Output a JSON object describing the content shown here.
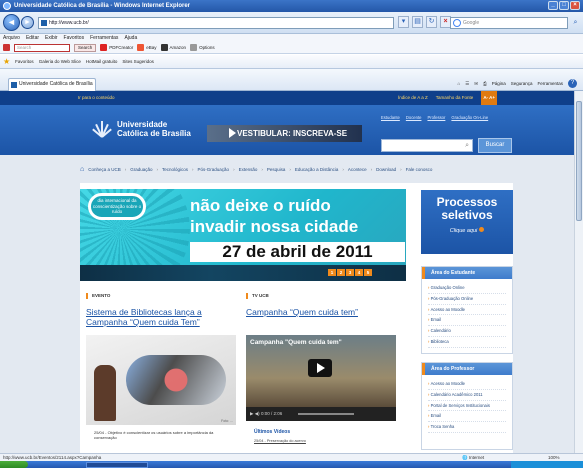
{
  "window": {
    "title": "Universidade Católica de Brasília - Windows Internet Explorer"
  },
  "address": {
    "url": "http://www.ucb.br/",
    "search_placeholder": "Google"
  },
  "menu": [
    "Arquivo",
    "Editar",
    "Exibir",
    "Favoritos",
    "Ferramentas",
    "Ajuda"
  ],
  "toolbar": {
    "search_placeholder": "Search",
    "search_btn": "Search",
    "items": [
      "PDFCreator",
      "eBay",
      "Amazon",
      "Options"
    ]
  },
  "favorites": {
    "label": "Favoritos",
    "items": [
      "Galeria do Web Slice",
      "HotMail gratuito",
      "Sites Sugeridos"
    ]
  },
  "tab": {
    "title": "Universidade Católica de Brasília"
  },
  "commandbar": [
    "Página",
    "Segurança",
    "Ferramentas"
  ],
  "site": {
    "skip_link": "Ir para o conteúdo",
    "access_links": [
      "Índice de A a Z",
      "Tamanho da Fonte"
    ],
    "access_badge": "A-  A+",
    "logo_line1": "Universidade",
    "logo_line2": "Católica de Brasília",
    "vestibular": "VESTIBULAR: INSCREVA-SE",
    "quick_links": [
      "Estudante",
      "Docente",
      "Professor",
      "Graduação On-Line"
    ],
    "search_button": "Buscar",
    "nav": [
      "Conheça a UCB",
      "Graduação",
      "Tecnológicos",
      "Pós-Graduação",
      "Extensão",
      "Pesquisa",
      "Educação a Distância",
      "Acontece",
      "Download",
      "Fale conosco"
    ]
  },
  "hero": {
    "badge": "dia internacional da conscientização sobre o ruído",
    "headline_line1": "não deixe o ruído",
    "headline_line2": "invadir nossa cidade",
    "date": "27 de abril de 2011",
    "pager": [
      "1",
      "2",
      "3",
      "4",
      "5"
    ]
  },
  "evento": {
    "label": "EVENTO",
    "title": "Sistema de Bibliotecas lança a Campanha “Quem cuida Tem”",
    "photo_caption": "Foto: ...",
    "desc": "25/04 - Objetivo é conscientizar os usuários sobre a importância da conservação"
  },
  "tv": {
    "label": "TV UCB",
    "title": "Campanha “Quem cuida tem”",
    "video_title": "Campanha \"Quem cuida tem\"",
    "time": "0:00 / 2:06",
    "recent_label": "Últimos Vídeos",
    "recent_item": "25/04 - Preservação do acervo"
  },
  "processos": {
    "title_line1": "Processos",
    "title_line2": "seletivos",
    "cta": "Clique aqui"
  },
  "aluno": {
    "head": "Área do Estudante",
    "items": [
      "Graduação Online",
      "Pós-Graduação Online",
      "Acesso ao Moodle",
      "Email",
      "Calendário",
      "Biblioteca"
    ]
  },
  "professor": {
    "head": "Área do Professor",
    "items": [
      "Acesso ao Moodle",
      "Calendário Acadêmico 2011",
      "Portal de Serviços Institucionais",
      "Email",
      "Troca Senha"
    ]
  },
  "status": {
    "url": "http://www.ucb.br/Eventos/2114.aspx?Campanha",
    "zone": "Internet",
    "zoom": "100%"
  }
}
